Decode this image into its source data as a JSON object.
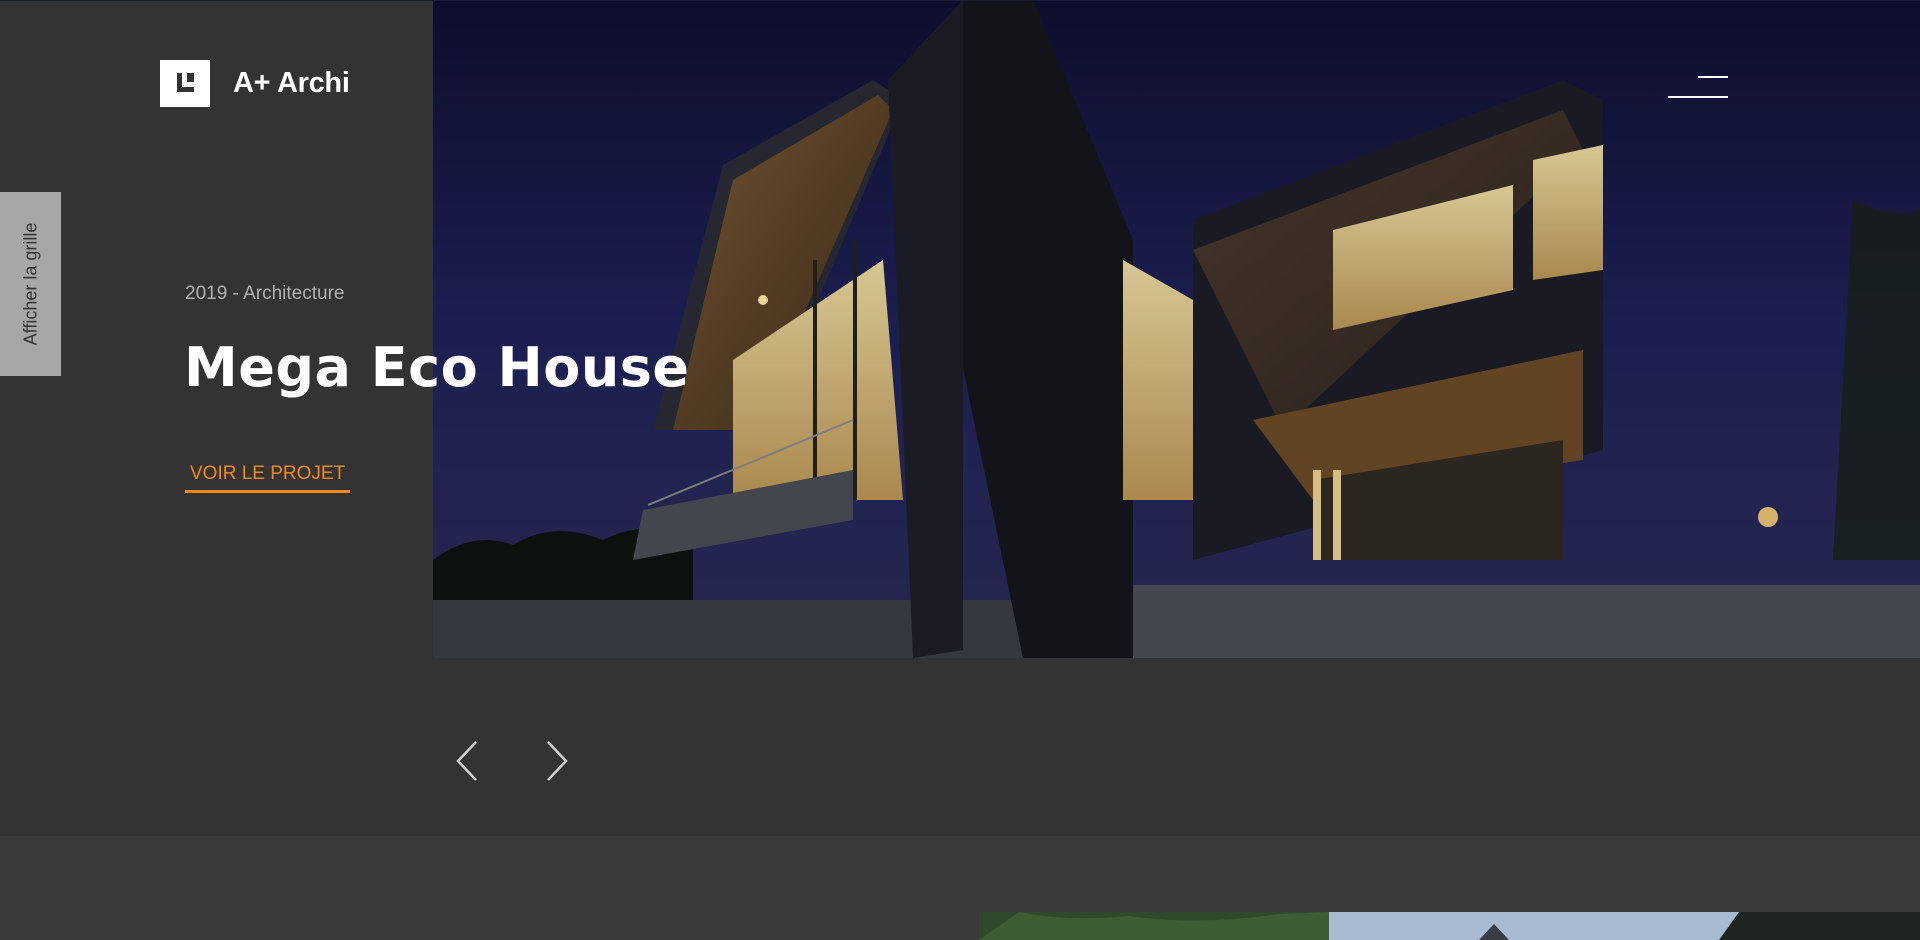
{
  "brand": {
    "name": "A+ Archi",
    "logo_icon": "logo-mark-icon"
  },
  "header": {
    "menu_icon": "hamburger-menu-icon"
  },
  "side_tab": {
    "label": "Afficher la grille"
  },
  "hero": {
    "meta": "2019 - Architecture",
    "title": "Mega Eco House",
    "cta_label": "VOIR LE PROJET",
    "image_icon": "house-photo"
  },
  "slider": {
    "prev_icon": "chevron-left-icon",
    "next_icon": "chevron-right-icon"
  },
  "colors": {
    "background": "#333333",
    "accent": "#f2891a",
    "tab": "#a7a7a7",
    "text_primary": "#ffffff",
    "text_muted": "#b0b0b0"
  }
}
